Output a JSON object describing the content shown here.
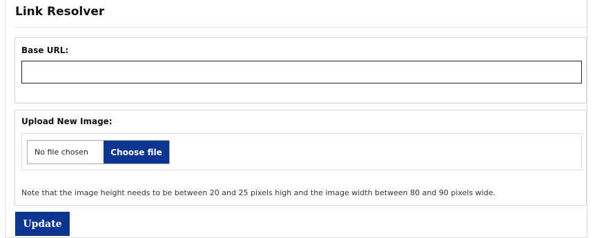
{
  "page": {
    "title": "Link Resolver"
  },
  "base_url": {
    "label": "Base URL:",
    "value": "",
    "placeholder": ""
  },
  "upload": {
    "label": "Upload New Image:",
    "file_status": "No file chosen",
    "choose_label": "Choose file",
    "note": "Note that the image height needs to be between 20 and 25 pixels high and the image width between 80 and 90 pixels wide."
  },
  "actions": {
    "update_label": "Update"
  },
  "colors": {
    "accent": "#0b3590",
    "border": "#d7d7d7",
    "text": "#1a1a1a"
  }
}
